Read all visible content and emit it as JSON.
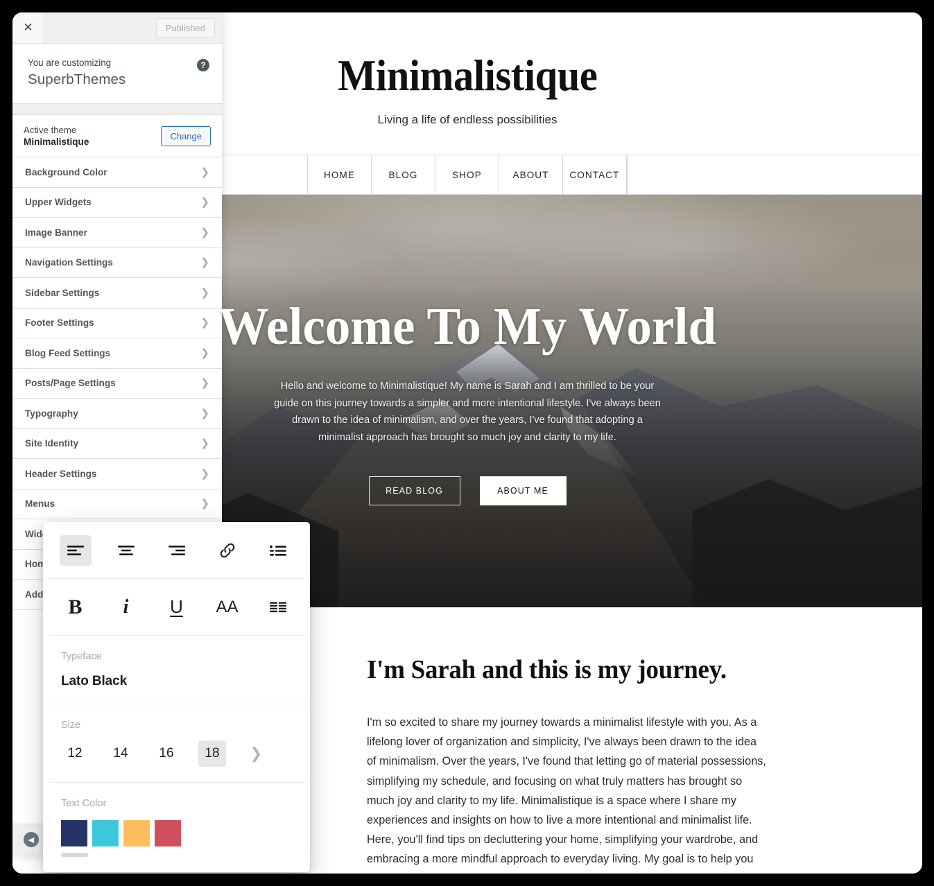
{
  "customizer": {
    "close_icon": "close-icon",
    "publish_label": "Published",
    "customizing_label": "You are customizing",
    "site_name": "SuperbThemes",
    "help_icon": "help-icon",
    "active_theme_label": "Active theme",
    "active_theme_name": "Minimalistique",
    "change_label": "Change",
    "collapse_icon": "collapse-icon",
    "sections": [
      {
        "label": "Background Color"
      },
      {
        "label": "Upper Widgets"
      },
      {
        "label": "Image Banner"
      },
      {
        "label": "Navigation Settings"
      },
      {
        "label": "Sidebar Settings"
      },
      {
        "label": "Footer Settings"
      },
      {
        "label": "Blog Feed Settings"
      },
      {
        "label": "Posts/Page Settings"
      },
      {
        "label": "Typography"
      },
      {
        "label": "Site Identity"
      },
      {
        "label": "Header Settings"
      },
      {
        "label": "Menus"
      },
      {
        "label": "Widgets"
      },
      {
        "label": "Homepage Settings"
      },
      {
        "label": "Additional CSS"
      }
    ]
  },
  "typography_panel": {
    "align_buttons": [
      {
        "name": "align-left-icon",
        "active": true
      },
      {
        "name": "align-center-icon",
        "active": false
      },
      {
        "name": "align-right-icon",
        "active": false
      },
      {
        "name": "link-icon",
        "active": false
      },
      {
        "name": "bulleted-list-icon",
        "active": false
      }
    ],
    "format_buttons": [
      {
        "name": "bold-icon",
        "label": "B"
      },
      {
        "name": "italic-icon",
        "label": "i"
      },
      {
        "name": "underline-icon",
        "label": "U"
      },
      {
        "name": "text-size-icon",
        "label": "AA"
      },
      {
        "name": "justify-icon",
        "label": ""
      }
    ],
    "typeface_label": "Typeface",
    "typeface_value": "Lato Black",
    "size_label": "Size",
    "sizes": [
      "12",
      "14",
      "16",
      "18"
    ],
    "selected_size": "18",
    "next_icon": "chevron-right-icon",
    "text_color_label": "Text Color",
    "colors": [
      "#253466",
      "#3CC8D8",
      "#FFBD5E",
      "#CF4F60"
    ]
  },
  "site": {
    "title": "Minimalistique",
    "tagline": "Living a life of endless possibilities",
    "nav": [
      "HOME",
      "BLOG",
      "SHOP",
      "ABOUT",
      "CONTACT"
    ],
    "hero": {
      "title": "Welcome To My World",
      "paragraph": "Hello and welcome to Minimalistique! My name is Sarah and I am thrilled to be your guide on this journey towards a simpler and more intentional lifestyle. I've always been drawn to the idea of minimalism, and over the years, I've found that adopting a minimalist approach has brought so much joy and clarity to my life.",
      "primary_button": "READ BLOG",
      "secondary_button": "ABOUT ME"
    },
    "article": {
      "title": "I'm Sarah and this is my journey.",
      "paragraph": "I'm so excited to share my journey towards a minimalist lifestyle with you. As a lifelong lover of organization and simplicity, I've always been drawn to the idea of minimalism. Over the years, I've found that letting go of material possessions, simplifying my schedule, and focusing on what truly matters has brought so much joy and clarity to my life. Minimalistique is a space where I share my experiences and insights on how to live a more intentional and minimalist life. Here, you'll find tips on decluttering your home, simplifying your wardrobe, and embracing a more mindful approach to everyday living. My goal is to help you create a home and a life that feels truly aligned with your values"
    }
  }
}
